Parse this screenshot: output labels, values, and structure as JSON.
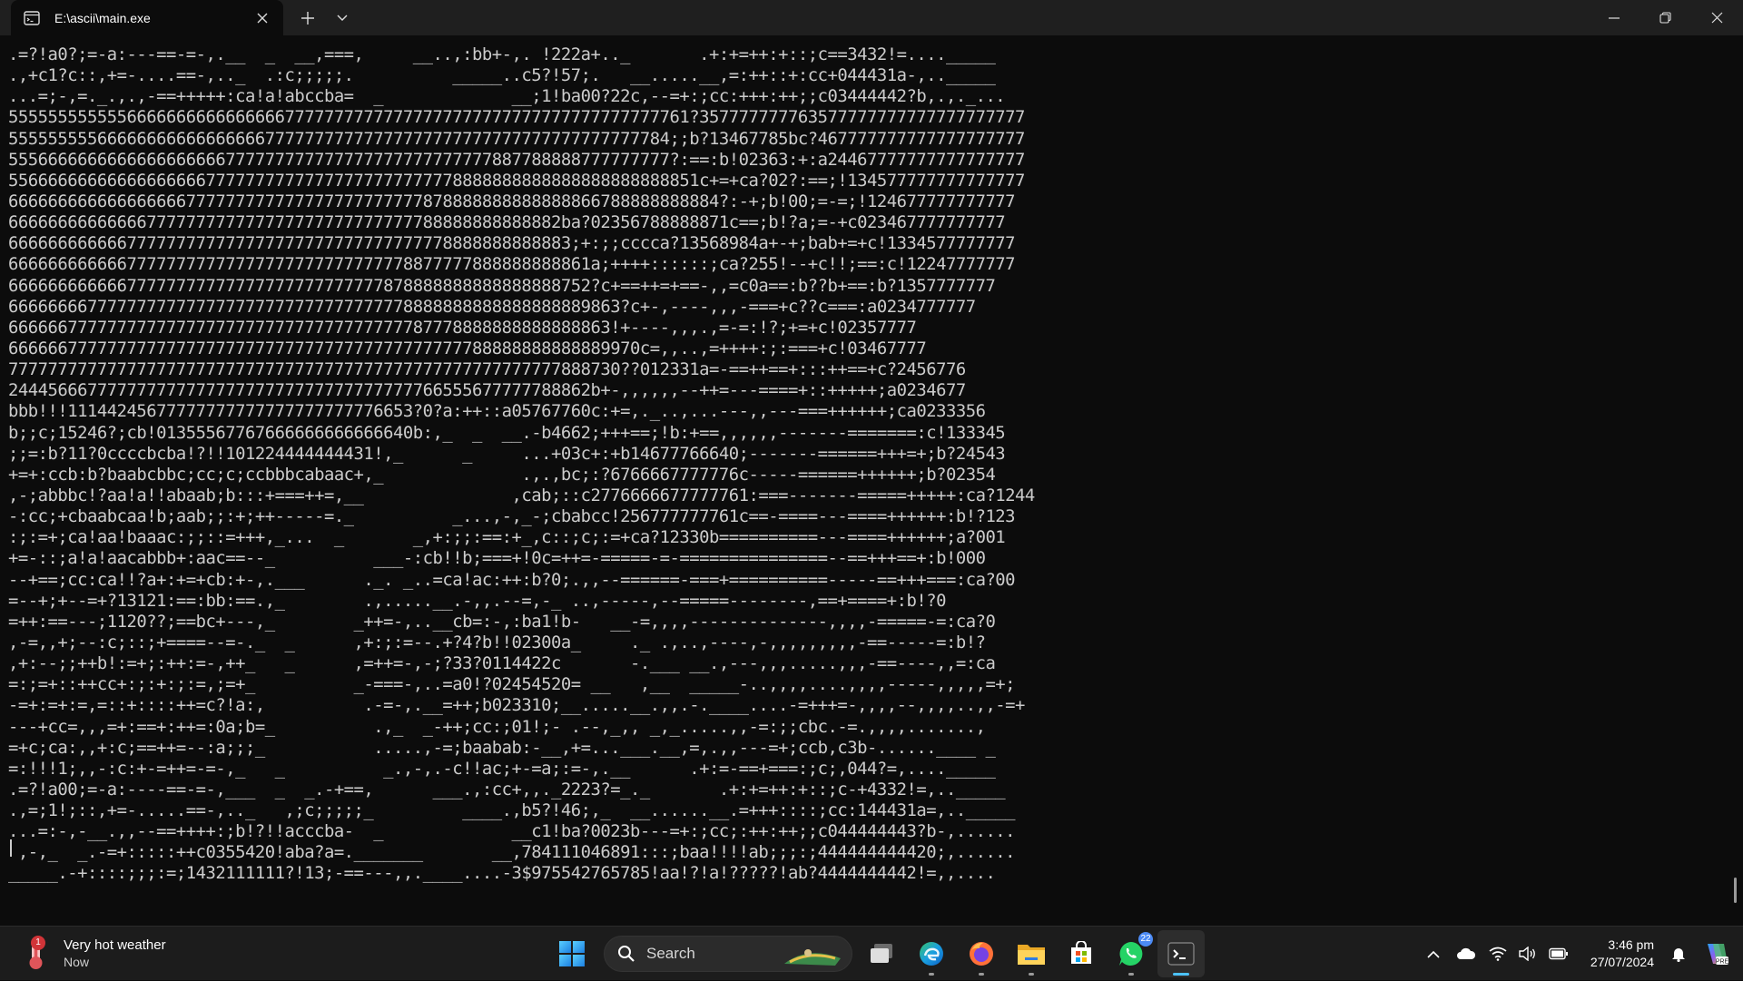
{
  "window": {
    "tab_title": "E:\\ascii\\main.exe",
    "new_tab_icon": "plus-icon",
    "dropdown_icon": "chevron-down-icon",
    "controls": [
      "minimize-icon",
      "restore-icon",
      "close-icon"
    ]
  },
  "console": {
    "lines": [
      ".=?!a0?;=-a:---==-=-,.__  _  __,===,     __..,:bb+-,. !222a+.._       .+:+=++:+::;c==3432!=...._____",
      ".,+c1?c::,+=-....==-,.._  .:c;;;;;.          _____..c5?!57;.   __.....__,=:++::+:cc+044431a-,.._____",
      "...=;-,=._.,.,-==+++++:ca!a!abccba=  _             __;1!ba00?22c,--=+:;cc:+++:++;;c03444442?b,.,._...",
      "555555555555666666666666666677777777777777777777777777777777777777761?357777777763577777777777777777777",
      "5555555556666666666666666677777777777777777777777777777777777777784;;b?13467785bc?467777777777777777777",
      "5556666666666666666666777777777777777777777777777887788888777777777?:==:b!02363:+:a24467777777777777777",
      "5566666666666666666677777777777777777777777778888888888888888888888851c+=+ca?02?:==;!134577777777777777",
      "666666666666666666777777777777777777777777878888888888888866788888888884?:-+;b!00;=-=;!124677777777777",
      "66666666666666777777777777777777777777777788888888888882ba?02356788888871c==;b!?a;=-+c023467777777777",
      "666666666666777777777777777777777777777777778888888888883;+:;;cccca?13568984a+-+;bab+=+c!1334577777777",
      "66666666666677777777777777777777777777778877777888888888861a;++++::::::;ca?255!--+c!!;==:c!12247777777",
      "66666666666677777777777777777777777777878888888888888888752?c+==++=+==-,,=c0a==:b??b+==:b?1357777777",
      "66666666777777777777777777777777777777778888888888888888889863?c+-,----,,,-===+c??c===:a0234777777",
      "6666667777777777777777777777777777777777787778888888888888863!+----,,,.,=-=:!?;+=+c!02357777",
      "6666667777777777777777777777777777777777777777788888888888889970c=,,..,=++++:;:===+c!03467777",
      "77777777777777777777777777777777777777777777777777777777888730??012331a=-==++==+:::++==+c?2456776",
      "24445666777777777777777777777777777777777766555677777788862b+-,,,,,,--++=---====+::+++++;a0234677",
      "bbb!!!11144245677777777777777777777776653?0?a:++::a05767760c:+=,._..,...---,,---===++++++;ca0233356",
      "b;;c;15246?;cb!01355567767666666666666640b:,_  _  __.-b4662;+++==;!b:+==,,,,,,-------=======:c!133345",
      ";;=:b?11?0ccccbcba!?!!101224444444431!,_      _     ...+03c+:+b14677766640;-------======+++=+;b?24543",
      "+=+:ccb:b?baabcbbc;cc;c;ccbbbcabaac+,_              .,.,bc;:?6766667777776c-----======++++++;b?02354",
      ",-;abbbc!?aa!a!!abaab;b:::+===++=,__               ,cab;::c2776666677777761:===-------=====+++++:ca?1244",
      "-:cc;+cbaabcaa!b;aab;;:+;++-----=._          _...,-,_-;cbabcc!256777777761c==-====---====++++++:b!?123",
      ":;:=+;ca!aa!baaac:;;::=+++,_...  _       _,+:;;:==:+_,c::;c;:=+ca?12330b==========---====++++++;a?001",
      "+=-::;a!a!aacabbb+:aac==--_          ___-:cb!!b;===+!0c=++=-=====-=-===============--==+++==+:b!000",
      "--+==;cc:ca!!?a+:+=+cb:+-,.___      ._. _..=ca!ac:++:b?0;.,,--======-===+==========-----==+++===:ca?00",
      "=--+;+--=+?13121:==:bb:==.,_        .,.....__.-,,.--=,-_ ..,-----,--=====--------,==+====+:b!?0",
      "=++:==---;1120??;==bc+---,_        _++=-,..__cb=:-,:ba1!b-   __-=,,,,--------------,,,,-=====-=:ca?0",
      ",-=,,+;--:c;::;+====--=-._  _      ,+:;:=--.+?4?b!!02300a_     ._ .,..,----,-,,,,,,,,,-==-----=:b!?",
      ",+:--;;++b!:=+;:++:=-,++_   _      ,=++=-,-;?33?0114422c       -.___ __.,---,,,.....,,,-==----,,=:ca",
      "=:;=+::++cc+:;:+:;:=,;=+_          _-===-,..=a0!?02454520= __   ,__  _____-..,,,,....,,,,-----,,,,,=+;",
      "-=+:=+:=,=::+::::++=c?!a:,          .-=-,.__=++;b023310;__.....__.,,.-.____....-=+++=-,,,,--,,,,..,,-=+",
      "---+cc=,,,=+:==+:++=:0a;b=_          .,_  _-++;cc:;01!;- .--,_,, _,_.....,,-=:;;cbc.-=.,,,,.......,",
      "=+c;ca:,,+:c;==++=--:a;;;_           .....,-=;baabab:-__,+=...___.__,=,.,,---=+;ccb,c3b-......____ _",
      "=:!!!1;,,-:c:+-=++=-=-,_   _          _.,-,.-c!!ac;+-=a;:=-,.__      .+:=-==+===:;c;,044?=,...._____",
      ".=?!a00;=-a:----==-=-,___  _  _.-+==,      ___.,:cc+,,._2223?=_._       .+:+=++:+::;c-+4332!=,.._____",
      ".,=;1!;::,+=-.....==-,.._   ,;c;;;;;_         ____.,b5?!46;,_  __......__.=+++::::;cc:144431a=,.._____",
      "...=:-,-__.,,--==++++:;b!?!!acccba-  _             __c1!ba?0023b---=+:;cc;:++:++;;c044444443?b-,......",
      " ,-,_  _.-=+:::::++c0355420!aba?a=._______       __,784111046891:::;baa!!!!ab;;;:;444444444420;,......",
      "_____.-+::::;;;:=;1432111111?!13;-==---,,.____....-3$975542765785!aa!?!a!?????!ab?4444444442!=,,...."
    ]
  },
  "taskbar": {
    "widget": {
      "badge": "1",
      "title": "Very hot weather",
      "subtitle": "Now",
      "icon": "thermometer-icon"
    },
    "search": {
      "label": "Search",
      "icon": "search-icon"
    },
    "apps": [
      {
        "name": "start",
        "icon": "windows-start-icon"
      },
      {
        "name": "task-view",
        "icon": "task-view-icon"
      },
      {
        "name": "edge",
        "icon": "edge-icon"
      },
      {
        "name": "firefox",
        "icon": "firefox-icon"
      },
      {
        "name": "file-explorer",
        "icon": "folder-icon"
      },
      {
        "name": "store",
        "icon": "store-icon"
      },
      {
        "name": "whatsapp",
        "icon": "whatsapp-icon",
        "badge": "22"
      },
      {
        "name": "terminal",
        "icon": "terminal-icon"
      }
    ],
    "tray": {
      "icons": [
        "chevron-up-icon",
        "onedrive-cloud-icon",
        "wifi-icon",
        "volume-icon",
        "battery-icon",
        "bell-icon",
        "copilot-icon"
      ],
      "time": "3:46 pm",
      "date": "27/07/2024"
    },
    "colors": {
      "accent": "#4cc2ff",
      "badge": "#d13438",
      "background": "#1c1c1c"
    }
  }
}
